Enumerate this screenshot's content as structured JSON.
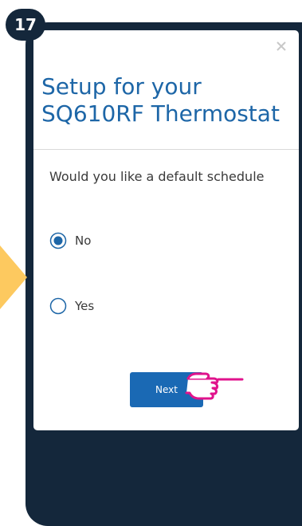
{
  "step": {
    "number": "17"
  },
  "modal": {
    "close_icon": "close-icon",
    "title": "Setup for your SQ610RF Thermostat",
    "question": "Would you like a default schedule",
    "options": [
      {
        "label": "No",
        "selected": true
      },
      {
        "label": "Yes",
        "selected": false
      }
    ],
    "next_label": "Next"
  },
  "colors": {
    "badge_bg": "#14273b",
    "phone_bg": "#14273b",
    "title": "#1d66a7",
    "radio_accent": "#1d66a7",
    "next_button": "#1a69b4",
    "pointer_arrow": "#fdc95f",
    "hand_outline": "#e0138c"
  },
  "icons": {
    "hand": "pointing-hand-icon"
  }
}
